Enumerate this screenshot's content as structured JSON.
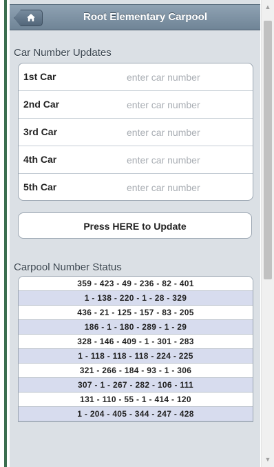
{
  "header": {
    "title": "Root Elementary Carpool",
    "home_icon": "home-icon"
  },
  "car_updates": {
    "section_label": "Car Number Updates",
    "rows": [
      {
        "label": "1st Car",
        "value": "",
        "placeholder": "enter car number"
      },
      {
        "label": "2nd Car",
        "value": "",
        "placeholder": "enter car number"
      },
      {
        "label": "3rd Car",
        "value": "",
        "placeholder": "enter car number"
      },
      {
        "label": "4th Car",
        "value": "",
        "placeholder": "enter car number"
      },
      {
        "label": "5th Car",
        "value": "",
        "placeholder": "enter car number"
      }
    ],
    "update_button_label": "Press HERE to Update"
  },
  "status": {
    "section_label": "Carpool Number Status",
    "rows": [
      "359 - 423 - 49 - 236 - 82 - 401",
      "1 - 138 - 220 - 1 - 28 - 329",
      "436 - 21 - 125 - 157 - 83 - 205",
      "186 - 1 - 180 - 289 - 1 - 29",
      "328 - 146 - 409 - 1 - 301 - 283",
      "1 - 118 - 118 - 118 - 224 - 225",
      "321 - 266 - 184 - 93 - 1 - 306",
      "307 - 1 - 267 - 282 - 106 - 111",
      "131 - 110 - 55 - 1 - 414 - 120",
      "1 - 204 - 405 - 344 - 247 - 428"
    ]
  },
  "colors": {
    "header": "#7b8fa1",
    "alt_row": "#d7dcee",
    "background": "#dbe0e5",
    "accent_bar": "#3b6e4f"
  }
}
